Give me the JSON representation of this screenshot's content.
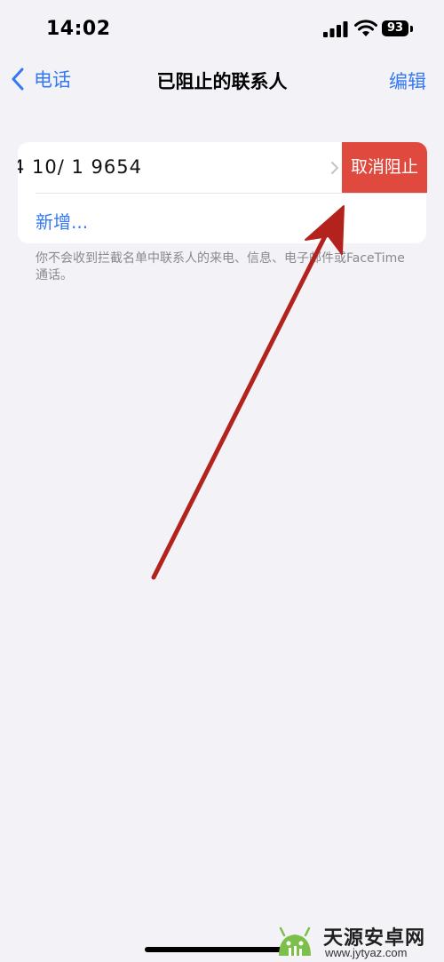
{
  "status_bar": {
    "time": "14:02",
    "battery_percent": "93",
    "signal_icon": "cellular-signal-icon",
    "wifi_icon": "wifi-icon"
  },
  "nav": {
    "back_label": "电话",
    "title": "已阻止的联系人",
    "edit_label": "编辑"
  },
  "blocked_list": {
    "items": [
      {
        "number": "4 10/ 1 9654",
        "swipe_action_label": "取消阻止"
      }
    ],
    "add_label": "新增..."
  },
  "footer_note": "你不会收到拦截名单中联系人的来电、信息、电子邮件或FaceTime 通话。",
  "watermark": {
    "title": "天源安卓网",
    "url": "www.jytyaz.com"
  },
  "colors": {
    "accent": "#3478f6",
    "destructive": "#e0493e",
    "background": "#f2f2f7",
    "annotation_arrow": "#b3221d"
  }
}
